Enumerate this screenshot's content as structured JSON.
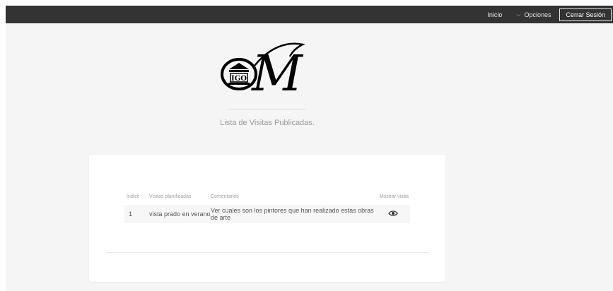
{
  "nav": {
    "home": "Inicio",
    "options": "Opciones",
    "logout": "Cerrar Sesión"
  },
  "logo": {
    "monogram": "M",
    "badge_text": "IGO"
  },
  "page": {
    "subtitle": "Lista de Visitas Publicadas."
  },
  "table": {
    "headers": [
      "Indice",
      "Visitas planificadas",
      "Comentarios",
      "Mostrar visita"
    ],
    "rows": [
      {
        "index": "1",
        "visit": "vista prado en verano",
        "comment": "Ver cuales son los pintores que han realizado estas obras de arte",
        "action_icon": "eye-icon"
      }
    ]
  },
  "colors": {
    "topbar": "#333333",
    "background": "#f5f5f5",
    "card": "#ffffff"
  }
}
